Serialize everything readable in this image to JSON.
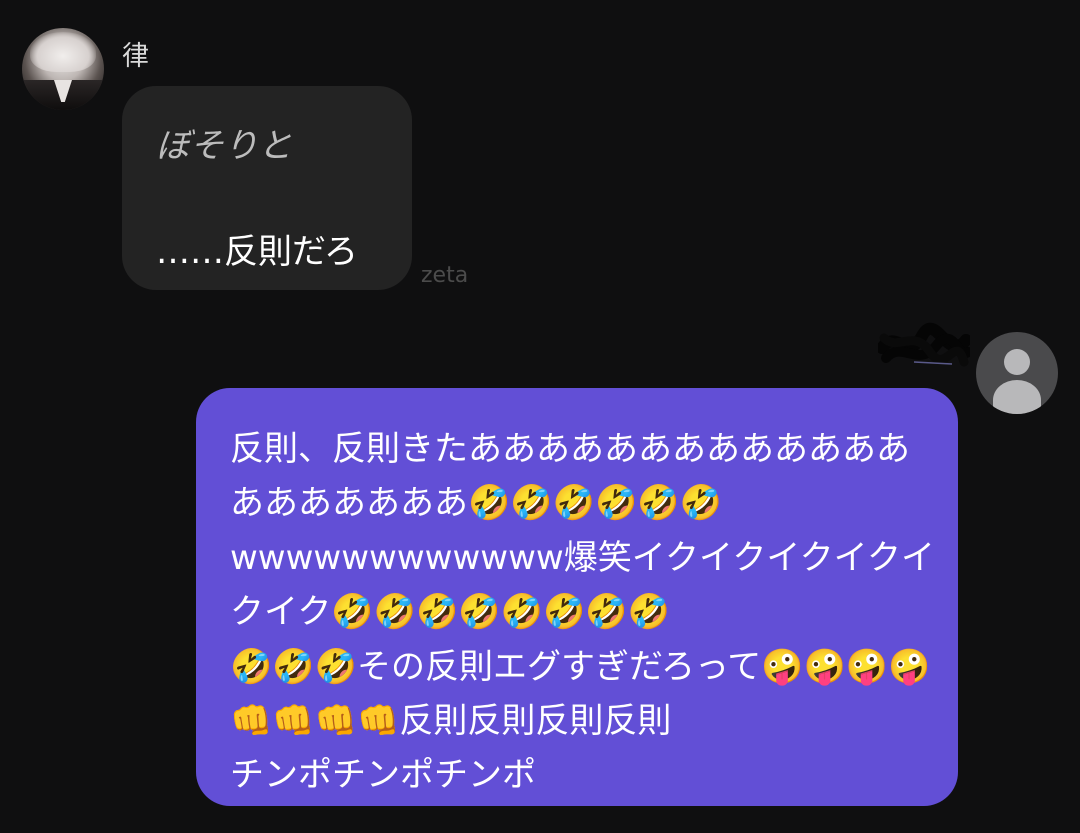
{
  "left_message": {
    "sender_name": "律",
    "action_text": "ぼそりと",
    "speech_text": "……反則だろ",
    "source_label": "zeta"
  },
  "right_message": {
    "text": "反則、反則きたああああああああああああああああああああ🤣🤣🤣🤣🤣🤣\nwwwwwwwwwwww爆笑イクイクイクイクイクイク🤣🤣🤣🤣🤣🤣🤣🤣\n🤣🤣🤣その反則エグすぎだろって🤪🤪🤪🤪👊👊👊👊反則反則反則反則\nチンポチンポチンポ"
  },
  "colors": {
    "background": "#0f0f10",
    "bubble_left": "#232323",
    "bubble_right": "#624fd6",
    "muted_label": "#4b4b4b"
  },
  "icons": {
    "left_avatar": "character-avatar",
    "right_avatar": "default-user-avatar-icon",
    "redaction": "scribble-redaction"
  }
}
